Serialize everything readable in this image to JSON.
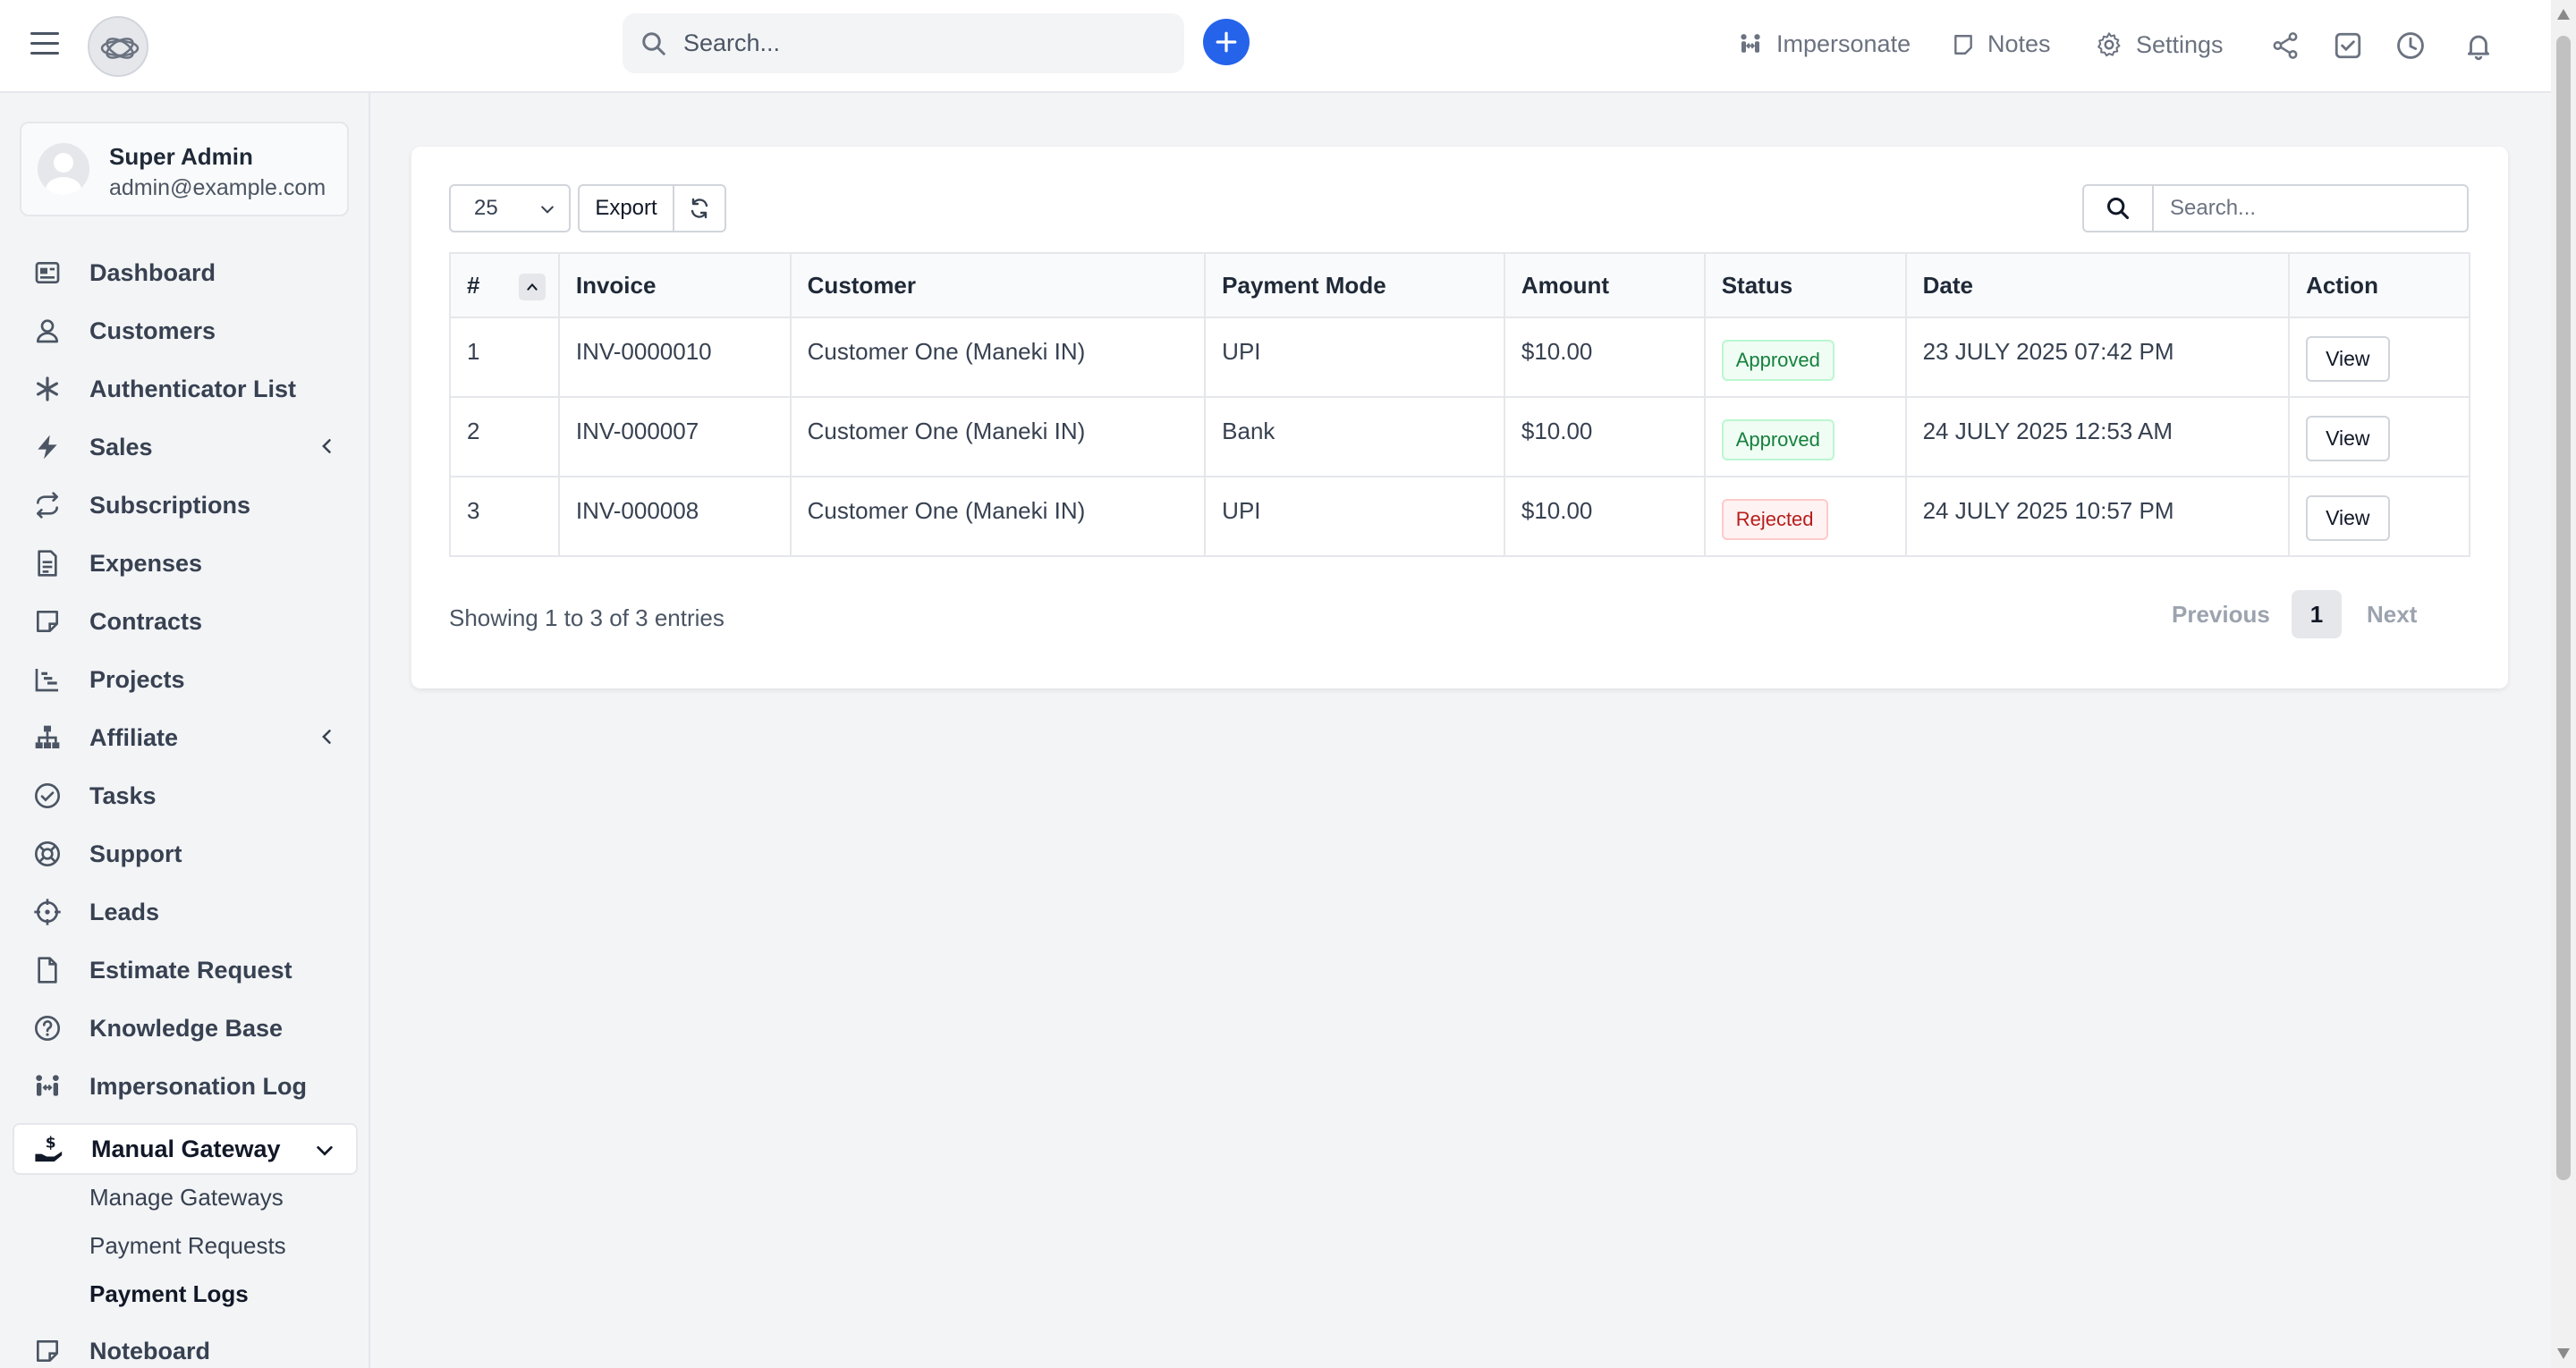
{
  "topbar": {
    "search_placeholder": "Search...",
    "impersonate_label": "Impersonate",
    "notes_label": "Notes",
    "settings_label": "Settings"
  },
  "user": {
    "name": "Super Admin",
    "email": "admin@example.com"
  },
  "sidebar": {
    "items": [
      {
        "label": "Dashboard",
        "icon": "dashboard-icon"
      },
      {
        "label": "Customers",
        "icon": "user-icon"
      },
      {
        "label": "Authenticator List",
        "icon": "asterisk-icon"
      },
      {
        "label": "Sales",
        "icon": "bolt-icon"
      },
      {
        "label": "Subscriptions",
        "icon": "repeat-icon"
      },
      {
        "label": "Expenses",
        "icon": "document-icon"
      },
      {
        "label": "Contracts",
        "icon": "sticky-note-icon"
      },
      {
        "label": "Projects",
        "icon": "chart-steps-icon"
      },
      {
        "label": "Affiliate",
        "icon": "sitemap-icon"
      },
      {
        "label": "Tasks",
        "icon": "check-circle-icon"
      },
      {
        "label": "Support",
        "icon": "lifebuoy-icon"
      },
      {
        "label": "Leads",
        "icon": "crosshair-icon"
      },
      {
        "label": "Estimate Request",
        "icon": "file-icon"
      },
      {
        "label": "Knowledge Base",
        "icon": "question-circle-icon"
      },
      {
        "label": "Impersonation Log",
        "icon": "people-arrows-icon"
      },
      {
        "label": "Manual Gateway",
        "icon": "hand-dollar-icon"
      },
      {
        "label": "Noteboard",
        "icon": "sticky-note-icon"
      }
    ],
    "sub_items": [
      {
        "label": "Manage Gateways"
      },
      {
        "label": "Payment Requests"
      },
      {
        "label": "Payment Logs"
      }
    ]
  },
  "toolbar": {
    "page_size": "25",
    "export_label": "Export",
    "search_placeholder": "Search..."
  },
  "table": {
    "headers": [
      "#",
      "Invoice",
      "Customer",
      "Payment Mode",
      "Amount",
      "Status",
      "Date",
      "Action"
    ],
    "rows": [
      {
        "num": "1",
        "invoice": "INV-0000010",
        "customer": "Customer One (Maneki IN)",
        "mode": "UPI",
        "amount": "$10.00",
        "status": "Approved",
        "date": "23 JULY 2025 07:42 PM",
        "action": "View"
      },
      {
        "num": "2",
        "invoice": "INV-000007",
        "customer": "Customer One (Maneki IN)",
        "mode": "Bank",
        "amount": "$10.00",
        "status": "Approved",
        "date": "24 JULY 2025 12:53 AM",
        "action": "View"
      },
      {
        "num": "3",
        "invoice": "INV-000008",
        "customer": "Customer One (Maneki IN)",
        "mode": "UPI",
        "amount": "$10.00",
        "status": "Rejected",
        "date": "24 JULY 2025 10:57 PM",
        "action": "View"
      }
    ]
  },
  "footer": {
    "showing": "Showing 1 to 3 of 3 entries",
    "previous": "Previous",
    "page": "1",
    "next": "Next"
  },
  "colors": {
    "accent": "#2563eb",
    "approved": "#15803d",
    "rejected": "#b91c1c"
  }
}
